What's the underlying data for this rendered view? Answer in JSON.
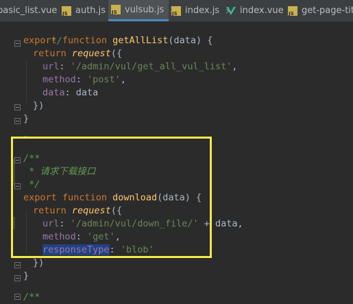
{
  "tabs": [
    {
      "label": "basic_list.vue",
      "type": "vue",
      "active": false
    },
    {
      "label": "auth.js",
      "type": "js",
      "active": false
    },
    {
      "label": "vulsub.js",
      "type": "js",
      "active": true
    },
    {
      "label": "index.js",
      "type": "js",
      "active": false
    },
    {
      "label": "index.vue",
      "type": "vue",
      "active": false
    },
    {
      "label": "get-page-title.js",
      "type": "js",
      "active": false
    }
  ],
  "close_glyph": "×",
  "code": {
    "l1_comment_end": "*/",
    "l2_export": "export",
    "l2_function": "function",
    "l2_name": "getAllList",
    "l2_rest": "(data) {",
    "l3_return": "return",
    "l3_call": "request",
    "l3_rest": "({",
    "l4_key": "url",
    "l4_colon": ": ",
    "l4_value": "'/admin/vul/get_all_vul_list'",
    "l4_comma": ",",
    "l5_key": "method",
    "l5_colon": ": ",
    "l5_value": "'post'",
    "l5_comma": ",",
    "l6_key": "data",
    "l6_rest": ": data",
    "l7": "})",
    "l8": "}",
    "l9_squiggle": "~",
    "l10": "/**",
    "l11": " * 请求下载接口",
    "l12": " */",
    "l13_export": "export",
    "l13_function": "function",
    "l13_name": "download",
    "l13_rest": "(data) {",
    "l14_return": "return",
    "l14_call": "request",
    "l14_rest": "({",
    "l15_key": "url",
    "l15_colon": ": ",
    "l15_value": "'/admin/vul/down_file/'",
    "l15_rest": " + data,",
    "l16_key": "method",
    "l16_colon": ": ",
    "l16_value": "'get'",
    "l16_comma": ",",
    "l17_key": "responseType",
    "l17_colon": ": ",
    "l17_value": "'blob'",
    "l18": "})",
    "l19": "}",
    "l20": "/**"
  },
  "colors": {
    "highlight_box": "#f5ea4b",
    "selection": "#214283",
    "editor_bg": "#2b2b2b"
  }
}
